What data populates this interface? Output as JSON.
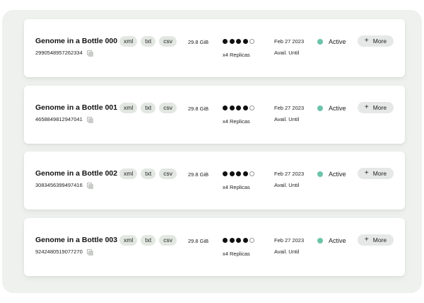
{
  "datasets": [
    {
      "title": "Genome in a Bottle 000",
      "id": "2990548957262334",
      "formats": [
        "xml",
        "txt",
        "csv"
      ],
      "size": "29.8 GiB",
      "replicas_filled": 4,
      "replicas_total": 5,
      "replicas_label": "x4 Replicas",
      "date": "Feb 27 2023",
      "avail_label": "Avail. Until",
      "status": "Active",
      "more_label": "More"
    },
    {
      "title": "Genome in a Bottle 001",
      "id": "4658849812947041",
      "formats": [
        "xml",
        "txt",
        "csv"
      ],
      "size": "29.8 GiB",
      "replicas_filled": 4,
      "replicas_total": 5,
      "replicas_label": "x4 Replicas",
      "date": "Feb 27 2023",
      "avail_label": "Avail. Until",
      "status": "Active",
      "more_label": "More"
    },
    {
      "title": "Genome in a Bottle 002",
      "id": "3083456399497416",
      "formats": [
        "xml",
        "txt",
        "csv"
      ],
      "size": "29.8 GiB",
      "replicas_filled": 4,
      "replicas_total": 5,
      "replicas_label": "x4 Replicas",
      "date": "Feb 27 2023",
      "avail_label": "Avail. Until",
      "status": "Active",
      "more_label": "More"
    },
    {
      "title": "Genome in a Bottle 003",
      "id": "9242480519077270",
      "formats": [
        "xml",
        "txt",
        "csv"
      ],
      "size": "29.8 GiB",
      "replicas_filled": 4,
      "replicas_total": 5,
      "replicas_label": "x4 Replicas",
      "date": "Feb 27 2023",
      "avail_label": "Avail. Until",
      "status": "Active",
      "more_label": "More"
    }
  ],
  "colors": {
    "status_active": "#6cc3aa",
    "panel_bg": "#eef1ee",
    "tag_bg": "#e2e8e1"
  },
  "icons": {
    "copy": "copy-icon",
    "plus": "plus-icon"
  }
}
